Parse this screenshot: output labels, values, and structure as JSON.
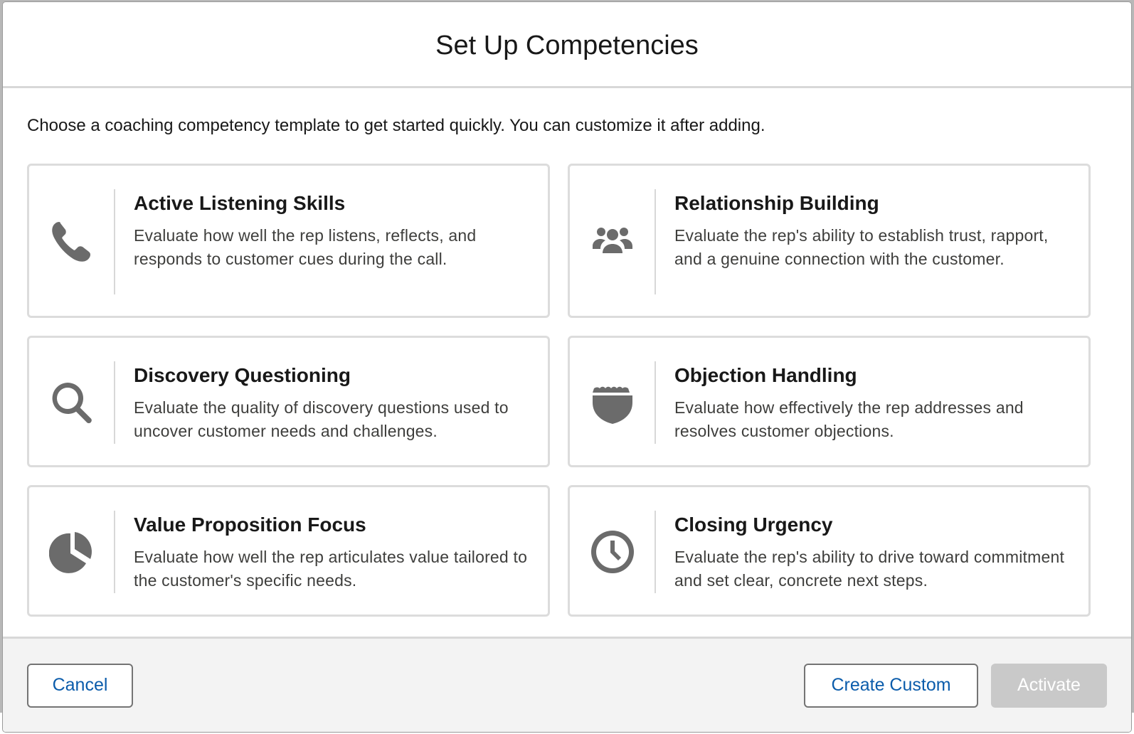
{
  "modal": {
    "title": "Set Up Competencies",
    "intro": "Choose a coaching competency template to get started quickly. You can customize it after adding."
  },
  "cards": [
    {
      "title": "Active Listening Skills",
      "description": "Evaluate how well the rep listens, reflects, and responds to customer cues during the call.",
      "icon": "phone-icon"
    },
    {
      "title": "Relationship Building",
      "description": "Evaluate the rep's ability to establish trust, rapport, and a genuine connection with the customer.",
      "icon": "group-icon"
    },
    {
      "title": "Discovery Questioning",
      "description": "Evaluate the quality of discovery questions used to uncover customer needs and challenges.",
      "icon": "search-icon"
    },
    {
      "title": "Objection Handling",
      "description": "Evaluate how effectively the rep addresses and resolves customer objections.",
      "icon": "shield-icon"
    },
    {
      "title": "Value Proposition Focus",
      "description": "Evaluate how well the rep articulates value tailored to the customer's specific needs.",
      "icon": "pie-chart-icon"
    },
    {
      "title": "Closing Urgency",
      "description": "Evaluate the rep's ability to drive toward commitment and set clear, concrete next steps.",
      "icon": "clock-icon"
    }
  ],
  "footer": {
    "cancel_label": "Cancel",
    "create_custom_label": "Create Custom",
    "activate_label": "Activate"
  },
  "colors": {
    "link_blue": "#0b5cab",
    "icon_gray": "#6b6b6b",
    "disabled_button": "#c9c9c9"
  }
}
